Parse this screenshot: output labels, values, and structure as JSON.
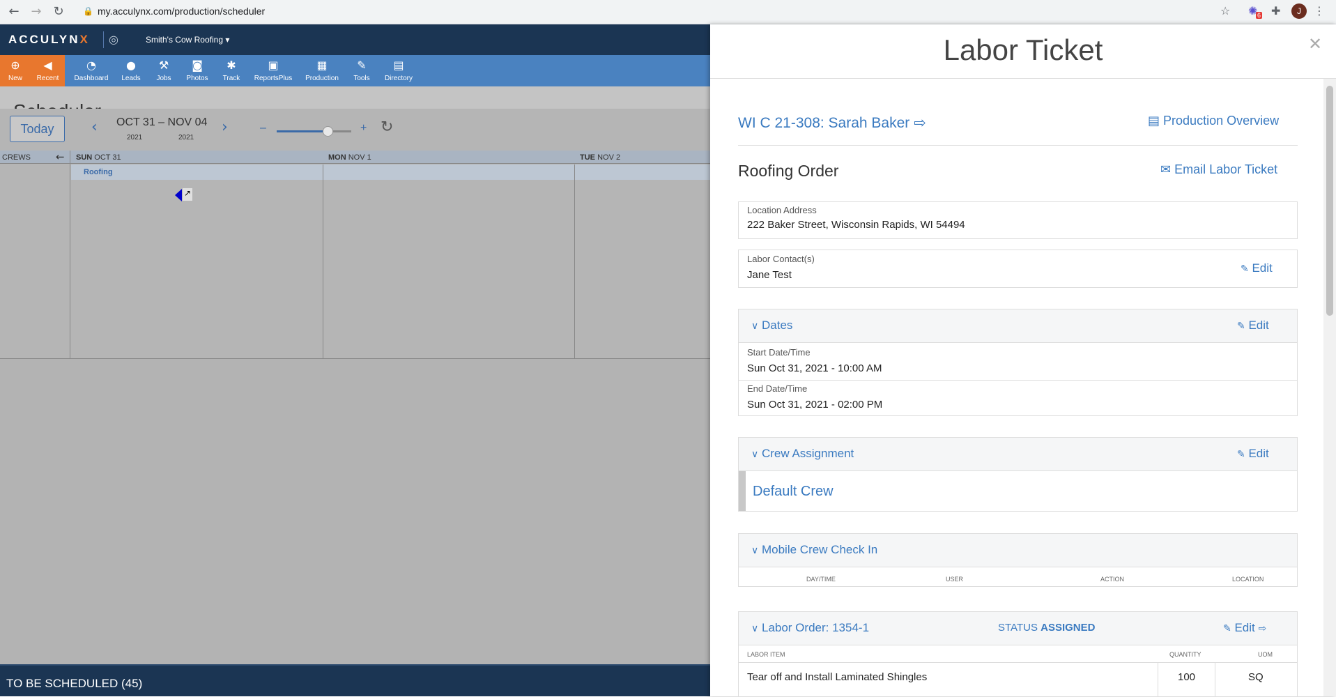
{
  "browser": {
    "url": "my.acculynx.com/production/scheduler",
    "extension_badge": "6",
    "avatar_initial": "J"
  },
  "app": {
    "logo_main": "ACCULYN",
    "logo_x": "X",
    "company": "Smith's Cow Roofing ▾",
    "toolbar": [
      {
        "label": "New",
        "icon": "plus-circle-icon",
        "glyph": "⊕"
      },
      {
        "label": "Recent",
        "icon": "back-circle-icon",
        "glyph": "◀"
      },
      {
        "label": "Dashboard",
        "icon": "gauge-icon",
        "glyph": "◔"
      },
      {
        "label": "Leads",
        "icon": "user-icon",
        "glyph": "●"
      },
      {
        "label": "Jobs",
        "icon": "hammer-icon",
        "glyph": "⚒"
      },
      {
        "label": "Photos",
        "icon": "camera-icon",
        "glyph": "◙"
      },
      {
        "label": "Track",
        "icon": "paw-icon",
        "glyph": "✱"
      },
      {
        "label": "ReportsPlus",
        "icon": "report-icon",
        "glyph": "▣"
      },
      {
        "label": "Production",
        "icon": "calendar-icon",
        "glyph": "▦"
      },
      {
        "label": "Tools",
        "icon": "wrench-icon",
        "glyph": "✎"
      },
      {
        "label": "Directory",
        "icon": "book-icon",
        "glyph": "▤"
      }
    ],
    "page_title": "Scheduler",
    "today": "Today",
    "date_range": "OCT 31  –  NOV 04",
    "year_start": "2021",
    "year_end": "2021",
    "zoom_minus": "–",
    "zoom_plus": "+",
    "zoom_level": 0.68,
    "crews_label": "CREWS",
    "days": [
      {
        "dow": "SUN",
        "date": "OCT 31"
      },
      {
        "dow": "MON",
        "date": "NOV 1"
      },
      {
        "dow": "TUE",
        "date": "NOV 2"
      }
    ],
    "row_label": "Roofing",
    "bottom_label": "TO BE SCHEDULED (45)"
  },
  "panel": {
    "title": "Labor Ticket",
    "job_link": "WI C 21-308: Sarah Baker",
    "production_overview": "Production Overview",
    "roofing_order": "Roofing Order",
    "email_ticket": "Email Labor Ticket",
    "location_label": "Location Address",
    "location_value": "222 Baker Street, Wisconsin Rapids, WI 54494",
    "contact_label": "Labor Contact(s)",
    "contact_value": "Jane Test",
    "edit": "Edit",
    "dates_title": "Dates",
    "start_label": "Start Date/Time",
    "start_value": "Sun Oct 31, 2021 - 10:00 AM",
    "end_label": "End Date/Time",
    "end_value": "Sun Oct 31, 2021 - 02:00 PM",
    "crew_title": "Crew Assignment",
    "crew_name": "Default Crew",
    "checkin_title": "Mobile Crew Check In",
    "checkin_cols": [
      "DAY/TIME",
      "USER",
      "ACTION",
      "LOCATION"
    ],
    "labor_title": "Labor Order: 1354-1",
    "status_label": "STATUS",
    "status_value": "ASSIGNED",
    "labor_cols": [
      "LABOR ITEM",
      "QUANTITY",
      "UOM"
    ],
    "labor_rows": [
      {
        "item": "Tear off and Install Laminated Shingles",
        "qty": "100",
        "uom": "SQ"
      }
    ]
  }
}
